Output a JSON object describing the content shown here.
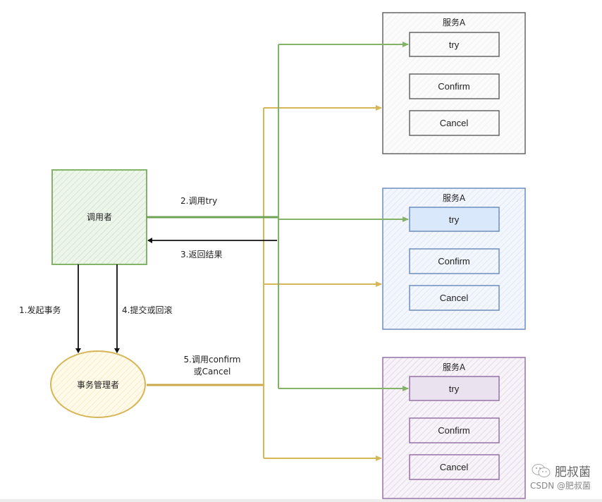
{
  "diagram": {
    "caller": {
      "label": "调用者"
    },
    "tx_manager": {
      "label": "事务管理者"
    },
    "services": [
      {
        "title": "服务A",
        "theme": "gray",
        "ops": [
          "try",
          "Confirm",
          "Cancel"
        ]
      },
      {
        "title": "服务A",
        "theme": "blue",
        "ops": [
          "try",
          "Confirm",
          "Cancel"
        ]
      },
      {
        "title": "服务A",
        "theme": "purple",
        "ops": [
          "try",
          "Confirm",
          "Cancel"
        ]
      }
    ],
    "edges": {
      "start_tx": "1.发起事务",
      "call_try": "2.调用try",
      "return_result": "3.返回结果",
      "commit_or_rollback": "4.提交或回滚",
      "call_confirm_line1": "5.调用confirm",
      "call_confirm_line2": "或Cancel"
    },
    "colors": {
      "green": "#82b366",
      "green_fill": "#d5e8d4",
      "yellow": "#d6b656",
      "yellow_fill": "#fff2cc",
      "gray": "#666666",
      "gray_fill": "#f5f5f5",
      "blue": "#6c8ebf",
      "blue_fill": "#dae8fc",
      "purple": "#9673a6",
      "purple_fill": "#e1d5e7",
      "black": "#111111"
    }
  },
  "watermark": {
    "name": "肥叔菌",
    "csdn": "CSDN @肥叔菌"
  }
}
